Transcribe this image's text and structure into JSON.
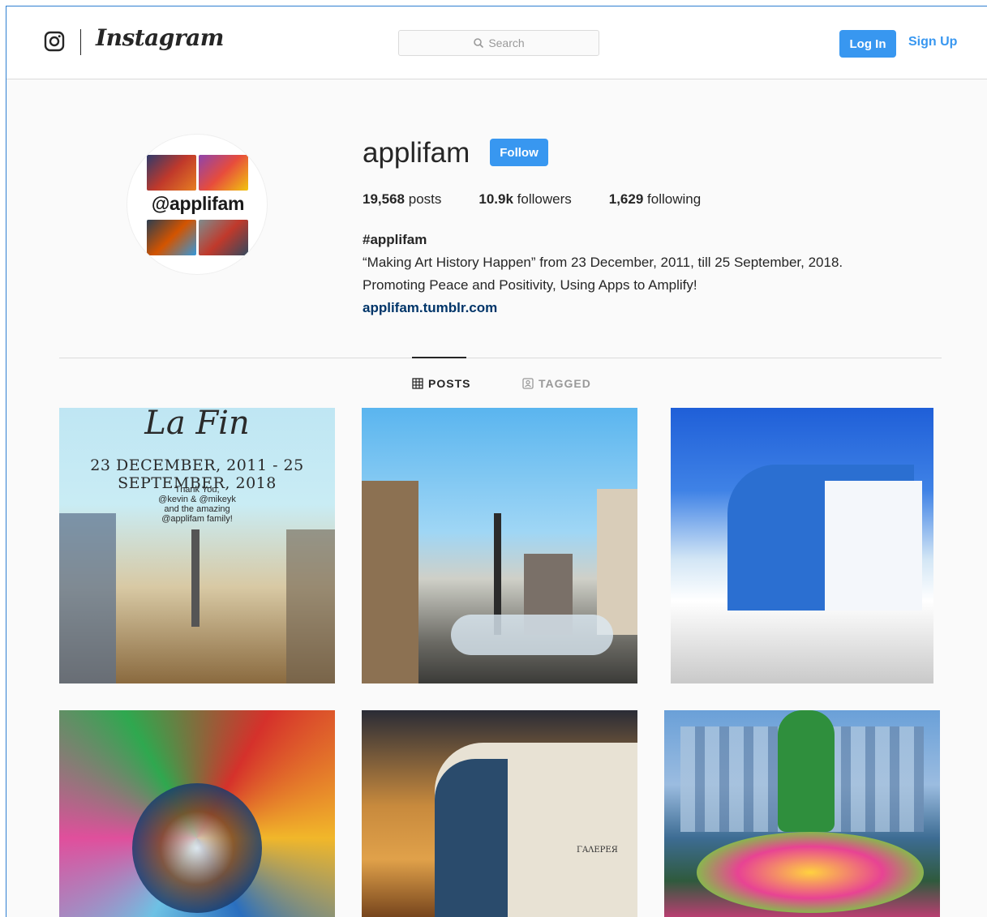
{
  "header": {
    "brand": "Instagram",
    "search_placeholder": "Search",
    "login_label": "Log In",
    "signup_label": "Sign Up"
  },
  "profile": {
    "avatar_text": "@applifam",
    "username": "applifam",
    "follow_label": "Follow",
    "stats": {
      "posts_count": "19,568",
      "posts_label": "posts",
      "followers_count": "10.9k",
      "followers_label": "followers",
      "following_count": "1,629",
      "following_label": "following"
    },
    "bio": {
      "name": "#applifam",
      "line1": "“Making Art History Happen” from 23 December, 2011, till 25 September, 2018.",
      "line2": "Promoting Peace and Positivity, Using Apps to Amplify!",
      "link": "applifam.tumblr.com"
    }
  },
  "tabs": [
    {
      "label": "POSTS",
      "icon": "grid-icon",
      "active": true
    },
    {
      "label": "TAGGED",
      "icon": "tagged-icon",
      "active": false
    }
  ],
  "posts": {
    "first_post_text": {
      "title": "La Fin",
      "dates": "23 DECEMBER, 2011 - 25 SEPTEMBER, 2018",
      "line1": "Thank You,",
      "line2": "@kevin & @mikeyk",
      "line3": "and the amazing",
      "line4": "@applifam family!"
    },
    "fifth_post_sign": "ΓΑΛΕΡΕЯ"
  },
  "colors": {
    "accent": "#3897f0",
    "text": "#262626",
    "link": "#003569",
    "muted": "#999999",
    "background": "#fafafa",
    "border": "#dbdbdb"
  }
}
